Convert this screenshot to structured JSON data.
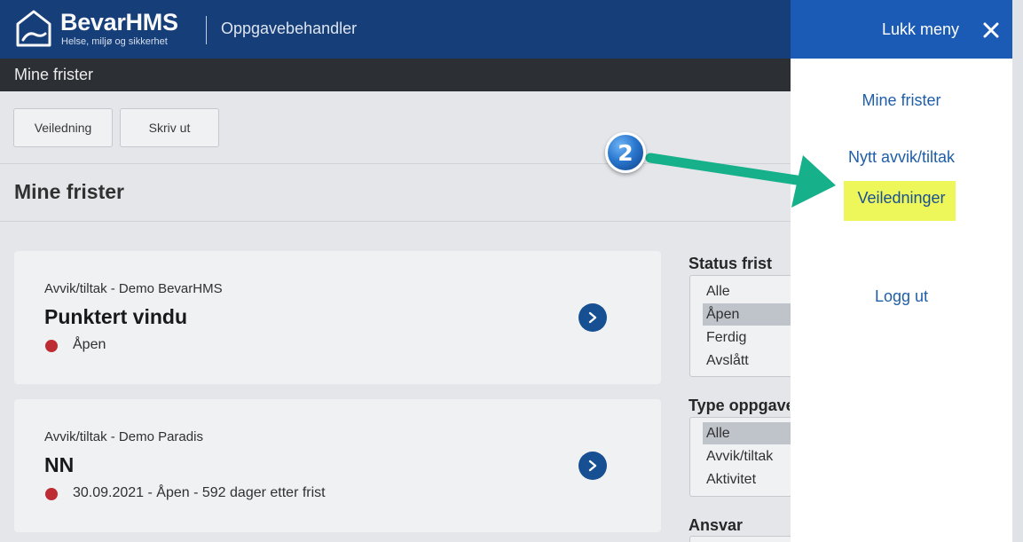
{
  "header": {
    "brand": "BevarHMS",
    "tagline": "Helse, miljø og sikkerhet",
    "app_title": "Oppgavebehandler"
  },
  "subheader": {
    "title": "Mine frister"
  },
  "toolbar": {
    "guide_label": "Veiledning",
    "print_label": "Skriv ut"
  },
  "main": {
    "title": "Mine frister",
    "tasks": [
      {
        "subtitle": "Avvik/tiltak - Demo BevarHMS",
        "title": "Punktert vindu",
        "status": "Åpen",
        "status_color": "#c0262b"
      },
      {
        "subtitle": "Avvik/tiltak - Demo Paradis",
        "title": "NN",
        "status": "30.09.2021 - Åpen - 592 dager etter frist",
        "status_color": "#c0262b"
      }
    ]
  },
  "filters": {
    "status": {
      "label": "Status frist",
      "options": [
        "Alle",
        "Åpen",
        "Ferdig",
        "Avslått"
      ],
      "selected": "Åpen"
    },
    "type": {
      "label": "Type oppgave",
      "options": [
        "Alle",
        "Avvik/tiltak",
        "Aktivitet"
      ],
      "selected": "Alle"
    },
    "responsibility": {
      "label": "Ansvar"
    }
  },
  "menu": {
    "close_label": "Lukk meny",
    "close_icon": "close-icon",
    "items": [
      "Mine frister",
      "Nytt avvik/tiltak",
      "Veiledninger",
      "Logg ut"
    ],
    "highlighted": "Veiledninger",
    "highlight_color": "#eef75a"
  },
  "annotation": {
    "step_number": "2",
    "arrow_color": "#16b08a"
  },
  "colors": {
    "header": "#0e3a78",
    "menu_header": "#1c5bb5",
    "link": "#1f5ea8",
    "accent_button": "#0f4c91"
  }
}
